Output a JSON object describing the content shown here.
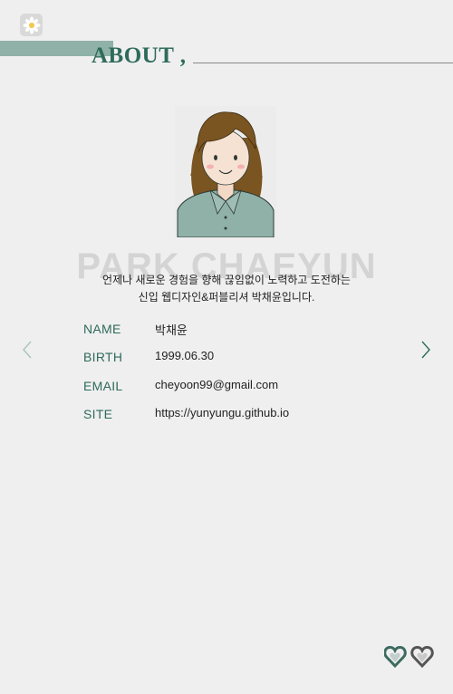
{
  "header": {
    "title": "ABOUT ,"
  },
  "profile": {
    "background_name": "PARK CHAEYUN",
    "intro_line1": "언제나 새로운 경험을 향해 끊임없이 노력하고 도전하는",
    "intro_line2": "신입 웹디자인&퍼블리셔 박채윤입니다."
  },
  "info": [
    {
      "label": "NAME",
      "value": "박채윤"
    },
    {
      "label": "BIRTH",
      "value": "1999.06.30"
    },
    {
      "label": "EMAIL",
      "value": "cheyoon99@gmail.com"
    },
    {
      "label": "SITE",
      "value": "https://yunyungu.github.io"
    }
  ],
  "icons": {
    "app": "daisy-icon",
    "prev": "chevron-left-icon",
    "next": "chevron-right-icon",
    "heart1": "heart-icon",
    "heart2": "heart-icon"
  },
  "colors": {
    "accent": "#8fb1a8",
    "title": "#2e6b5a",
    "background": "#efefef",
    "heart_green": "#3d6b5f",
    "heart_gray": "#555555"
  }
}
